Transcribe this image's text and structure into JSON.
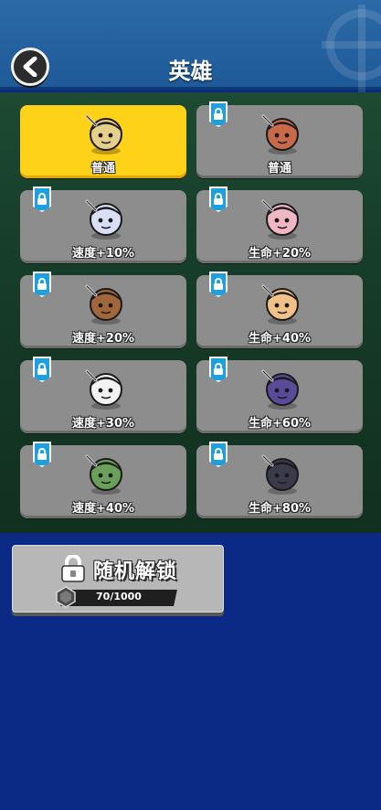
{
  "header": {
    "title": "英雄"
  },
  "heroes": [
    {
      "label": "普通",
      "bonus": "",
      "locked": false,
      "selected": true,
      "color": "#e6cf8a",
      "accent": "#6a4a2a"
    },
    {
      "label": "普通",
      "bonus": "",
      "locked": true,
      "selected": false,
      "color": "#c86a4a",
      "accent": "#6b7a84"
    },
    {
      "label": "速度",
      "bonus": "+10%",
      "locked": true,
      "selected": false,
      "color": "#d9dff5",
      "accent": "#3a2f7a"
    },
    {
      "label": "生命",
      "bonus": "+20%",
      "locked": true,
      "selected": false,
      "color": "#f0b6c4",
      "accent": "#e9e9e9"
    },
    {
      "label": "速度",
      "bonus": "+20%",
      "locked": true,
      "selected": false,
      "color": "#a2663b",
      "accent": "#5a3b22"
    },
    {
      "label": "生命",
      "bonus": "+40%",
      "locked": true,
      "selected": false,
      "color": "#f0c28a",
      "accent": "#3b3f9a"
    },
    {
      "label": "速度",
      "bonus": "+30%",
      "locked": true,
      "selected": false,
      "color": "#f2f2f2",
      "accent": "#d6a640"
    },
    {
      "label": "生命",
      "bonus": "+60%",
      "locked": true,
      "selected": false,
      "color": "#5a4a9a",
      "accent": "#f2f2f2"
    },
    {
      "label": "速度",
      "bonus": "+40%",
      "locked": true,
      "selected": false,
      "color": "#6aa05a",
      "accent": "#e98a5a"
    },
    {
      "label": "生命",
      "bonus": "+80%",
      "locked": true,
      "selected": false,
      "color": "#3a3a4a",
      "accent": "#f0c020"
    }
  ],
  "unlock": {
    "label": "随机解锁",
    "progress_text": "70/1000",
    "progress": 0.07
  },
  "icons": {
    "back": "chevron-left-icon",
    "lock": "padlock-icon",
    "gem": "gem-icon",
    "crosshair": "crosshair-icon"
  }
}
